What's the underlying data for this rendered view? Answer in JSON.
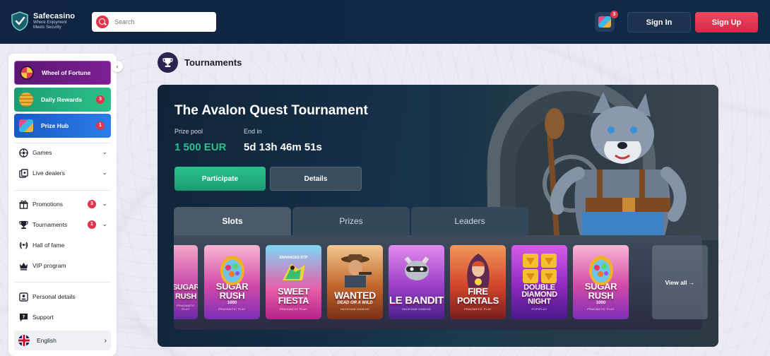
{
  "header": {
    "brand_name": "Safecasino",
    "brand_tagline": "Where Enjoyment Meets Security",
    "search_placeholder": "Search",
    "gift_badge": "3",
    "signin_label": "Sign In",
    "signup_label": "Sign Up"
  },
  "sidebar": {
    "promos": [
      {
        "label": "Wheel of Fortune",
        "badge": ""
      },
      {
        "label": "Daily Rewards",
        "badge": "3"
      },
      {
        "label": "Prize Hub",
        "badge": "1"
      }
    ],
    "nav": [
      {
        "label": "Games",
        "icon": "games-icon",
        "badge": "",
        "expandable": true
      },
      {
        "label": "Live dealers",
        "icon": "live-dealers-icon",
        "badge": "",
        "expandable": true
      },
      {
        "label": "Promotions",
        "icon": "gift-icon",
        "badge": "3",
        "expandable": true
      },
      {
        "label": "Tournaments",
        "icon": "trophy-icon",
        "badge": "1",
        "expandable": true
      },
      {
        "label": "Hall of fame",
        "icon": "laurel-icon",
        "badge": "",
        "expandable": false
      },
      {
        "label": "VIP program",
        "icon": "crown-icon",
        "badge": "",
        "expandable": false
      },
      {
        "label": "Personal details",
        "icon": "user-icon",
        "badge": "",
        "expandable": false
      },
      {
        "label": "Support",
        "icon": "chat-icon",
        "badge": "",
        "expandable": false
      }
    ],
    "language": "English"
  },
  "main": {
    "page_title": "Tournaments",
    "tournament": {
      "title": "The Avalon Quest Tournament",
      "prize_label": "Prize pool",
      "prize_value": "1 500 EUR",
      "end_label": "End in",
      "end_value": "5d 13h 46m 51s",
      "participate_label": "Participate",
      "details_label": "Details"
    },
    "tabs": [
      {
        "label": "Slots",
        "active": true
      },
      {
        "label": "Prizes",
        "active": false
      },
      {
        "label": "Leaders",
        "active": false
      }
    ],
    "games": [
      {
        "title": "SUGAR RUSH",
        "sub": "",
        "provider": "PRAGMATIC PLAY",
        "partial": true
      },
      {
        "title": "SUGAR RUSH",
        "sub": "1000",
        "provider": "PRAGMATIC PLAY"
      },
      {
        "title": "SWEET FIESTA",
        "sub": "ENHANCED RTP",
        "provider": "PRAGMATIC PLAY"
      },
      {
        "title": "WANTED",
        "sub": "DEAD OR A WILD",
        "provider": "HACKSAW GAMING"
      },
      {
        "title": "LE BANDIT",
        "sub": "",
        "provider": "HACKSAW GAMING"
      },
      {
        "title": "FIRE PORTALS",
        "sub": "",
        "provider": "PRAGMATIC PLAY"
      },
      {
        "title": "DOUBLE DIAMOND NIGHT",
        "sub": "",
        "provider": "POPIPLAY"
      },
      {
        "title": "SUGAR RUSH",
        "sub": "1000",
        "provider": "PRAGMATIC PLAY"
      }
    ],
    "view_all_label": "View all →"
  },
  "colors": {
    "header_bg": "#0e2440",
    "accent_red": "#e3344e",
    "accent_green": "#2ac08e",
    "hero_bg": "#153048"
  }
}
